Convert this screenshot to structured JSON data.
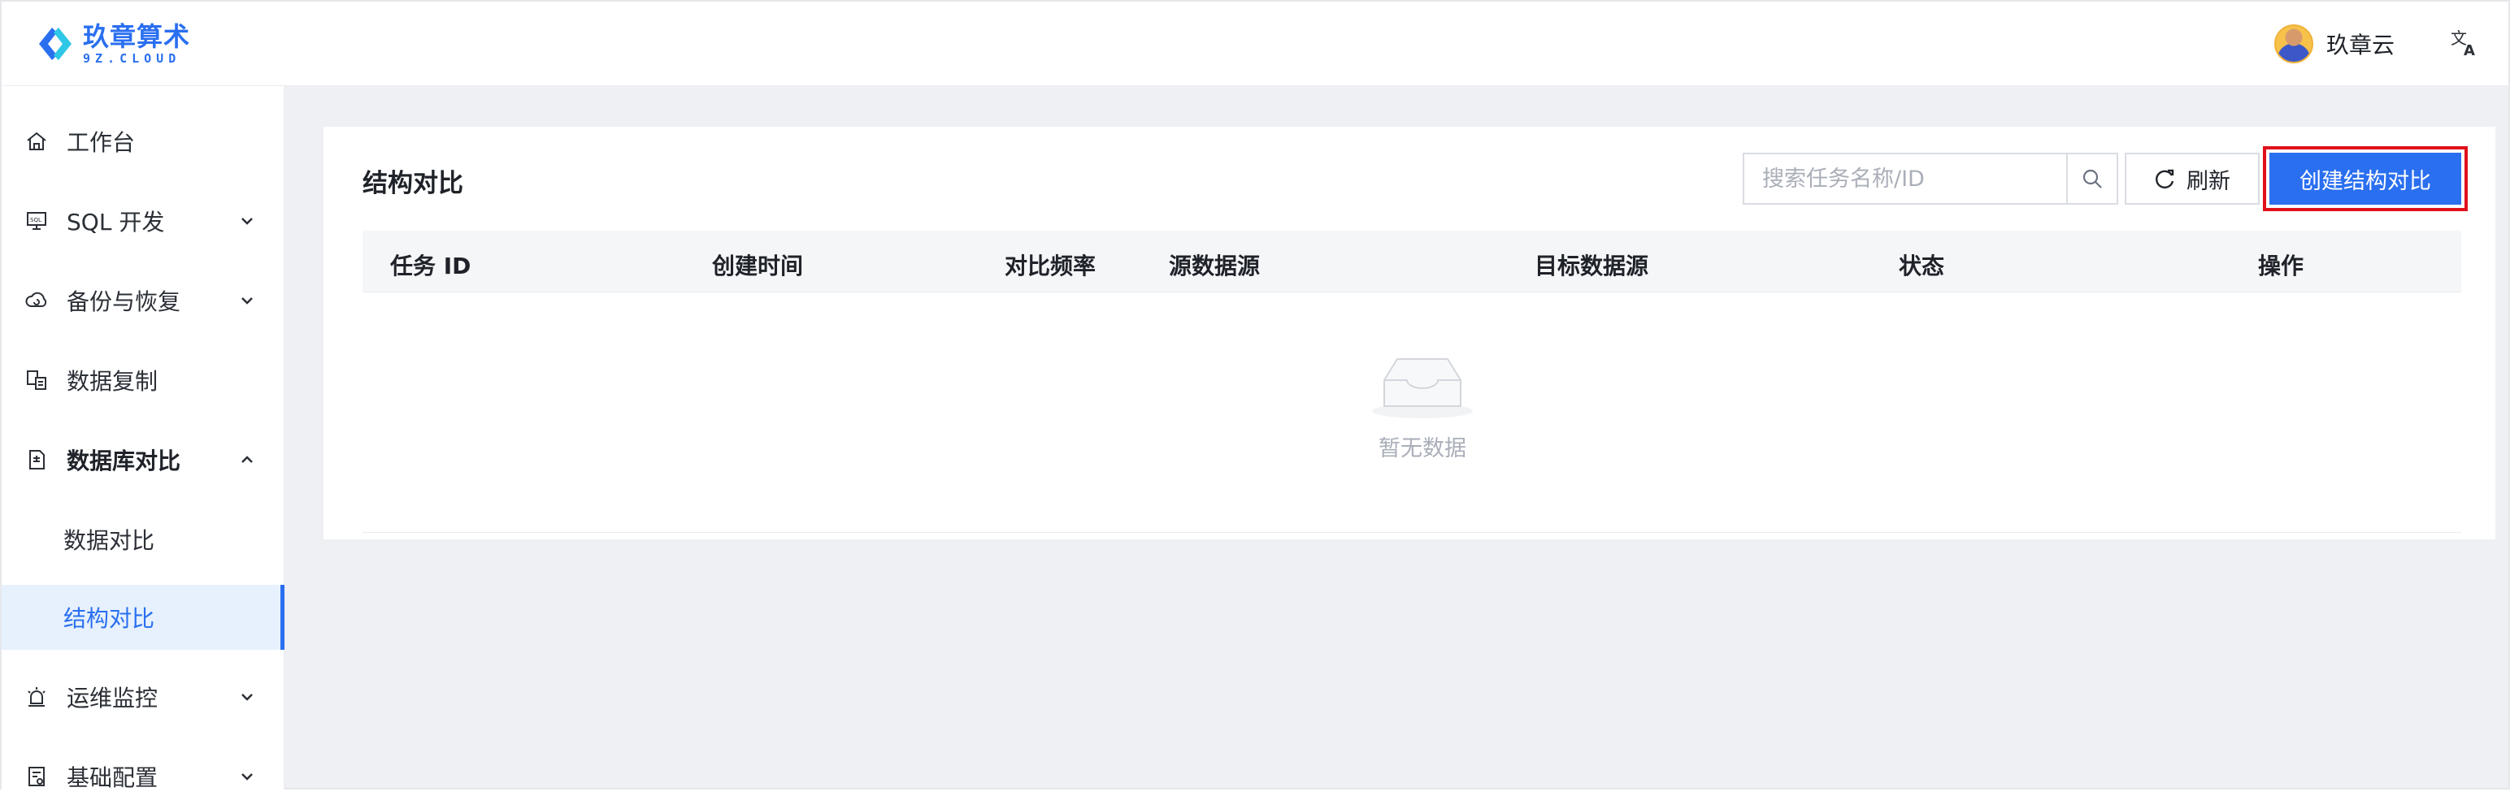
{
  "brand": {
    "name_cn": "玖章算术",
    "name_en": "9Z.CLOUD",
    "color": "#2a6ff0"
  },
  "header": {
    "user_name": "玖章云",
    "lang_icon": "translate-icon"
  },
  "sidebar": {
    "items": [
      {
        "label": "工作台",
        "icon": "home-icon"
      },
      {
        "label": "SQL 开发",
        "icon": "sql-monitor-icon"
      },
      {
        "label": "备份与恢复",
        "icon": "cloud-backup-icon"
      },
      {
        "label": "数据复制",
        "icon": "copy-data-icon"
      },
      {
        "label": "数据库对比",
        "icon": "compare-doc-icon",
        "expanded": true
      },
      {
        "label": "运维监控",
        "icon": "alarm-icon"
      },
      {
        "label": "基础配置",
        "icon": "config-icon"
      }
    ],
    "sub_items": [
      {
        "label": "数据对比"
      },
      {
        "label": "结构对比",
        "active": true
      }
    ]
  },
  "main": {
    "title": "结构对比",
    "search": {
      "placeholder": "搜索任务名称/ID",
      "value": ""
    },
    "refresh_label": "刷新",
    "create_label": "创建结构对比",
    "table": {
      "columns": [
        "任务 ID",
        "创建时间",
        "对比频率",
        "源数据源",
        "目标数据源",
        "状态",
        "操作"
      ],
      "rows": []
    },
    "empty_text": "暂无数据"
  },
  "colors": {
    "accent": "#2a6ff0",
    "highlight": "#e0101a",
    "active_bg": "#e6f1fd"
  }
}
